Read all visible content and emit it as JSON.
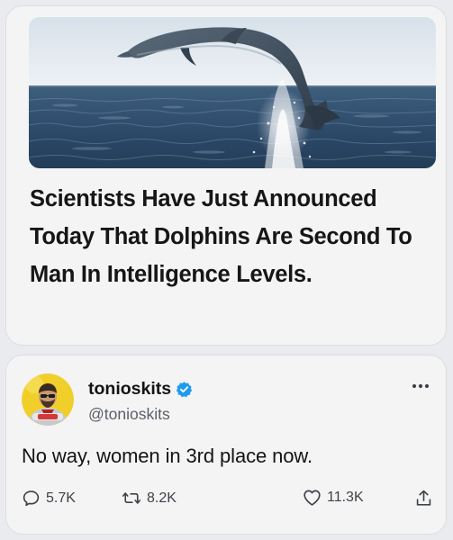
{
  "news": {
    "headline": "Scientists Have Just Announced Today That Dolphins Are Second To Man In Intelligence Levels."
  },
  "tweet": {
    "display_name": "tonioskits",
    "handle": "@tonioskits",
    "text": "No way, women in 3rd place now.",
    "replies": "5.7K",
    "reposts": "8.2K",
    "likes": "11.3K"
  },
  "icons": {
    "verified": "verified-badge-icon",
    "more": "more-options-icon",
    "reply": "comment-bubble-icon",
    "repost": "repost-arrows-icon",
    "like": "heart-icon",
    "share": "share-upload-icon"
  },
  "colors": {
    "verified": "#1d9bf0",
    "text": "#141414",
    "muted": "#5a5f66"
  }
}
